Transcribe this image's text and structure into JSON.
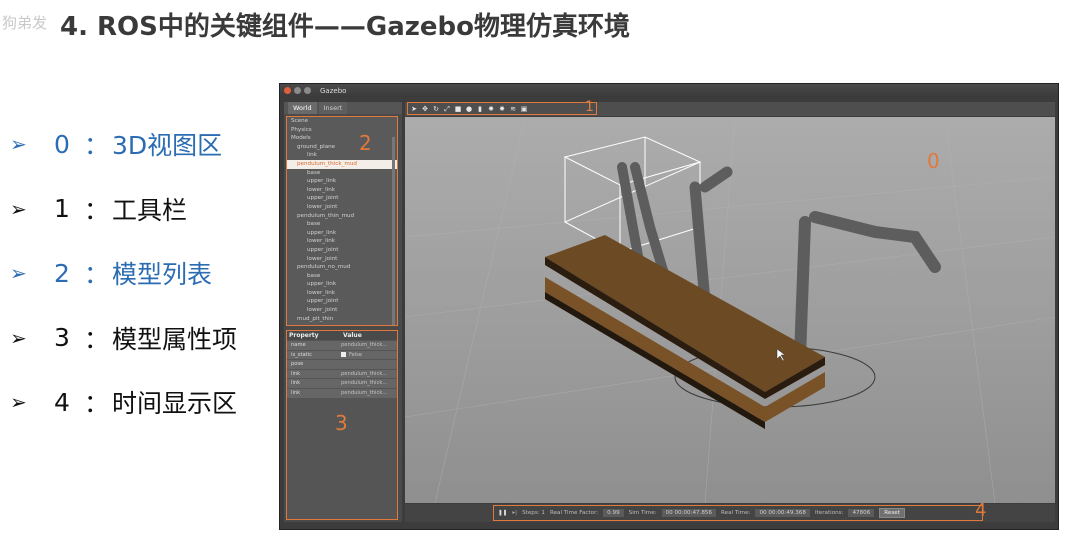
{
  "slide": {
    "title": "4. ROS中的关键组件——Gazebo物理仿真环境",
    "watermark": "狗弟发"
  },
  "bullets": [
    {
      "num": "0",
      "text": "3D视图区",
      "highlight": true
    },
    {
      "num": "1",
      "text": "工具栏",
      "highlight": false
    },
    {
      "num": "2",
      "text": "模型列表",
      "highlight": true
    },
    {
      "num": "3",
      "text": "模型属性项",
      "highlight": false
    },
    {
      "num": "4",
      "text": "时间显示区",
      "highlight": false
    }
  ],
  "bullet_marker": "➢",
  "bullet_colon": "：",
  "gazebo": {
    "window_title": "Gazebo",
    "tabs": [
      "World",
      "Insert"
    ],
    "tree": [
      {
        "label": "Scene",
        "indent": 0
      },
      {
        "label": "Physics",
        "indent": 0
      },
      {
        "label": "Models",
        "indent": 0
      },
      {
        "label": "ground_plane",
        "indent": 1
      },
      {
        "label": "link",
        "indent": 2
      },
      {
        "label": "pendulum_thick_mud",
        "indent": 1,
        "selected": true
      },
      {
        "label": "base",
        "indent": 2
      },
      {
        "label": "upper_link",
        "indent": 2
      },
      {
        "label": "lower_link",
        "indent": 2
      },
      {
        "label": "upper_joint",
        "indent": 2
      },
      {
        "label": "lower_joint",
        "indent": 2
      },
      {
        "label": "pendulum_thin_mud",
        "indent": 1
      },
      {
        "label": "base",
        "indent": 2
      },
      {
        "label": "upper_link",
        "indent": 2
      },
      {
        "label": "lower_link",
        "indent": 2
      },
      {
        "label": "upper_joint",
        "indent": 2
      },
      {
        "label": "lower_joint",
        "indent": 2
      },
      {
        "label": "pendulum_no_mud",
        "indent": 1
      },
      {
        "label": "base",
        "indent": 2
      },
      {
        "label": "upper_link",
        "indent": 2
      },
      {
        "label": "lower_link",
        "indent": 2
      },
      {
        "label": "upper_joint",
        "indent": 2
      },
      {
        "label": "lower_joint",
        "indent": 2
      },
      {
        "label": "mud_pit_thin",
        "indent": 1
      }
    ],
    "props_header": {
      "property": "Property",
      "value": "Value"
    },
    "props": [
      {
        "key": "name",
        "value": "pendulum_thick..."
      },
      {
        "key": "is_static",
        "value": "False",
        "checkbox": true
      },
      {
        "key": "pose",
        "value": ""
      },
      {
        "key": "link",
        "value": "pendulum_thick..."
      },
      {
        "key": "link",
        "value": "pendulum_thick..."
      },
      {
        "key": "link",
        "value": "pendulum_thick..."
      }
    ],
    "toolbar_icons": [
      "select-arrow",
      "translate",
      "rotate",
      "scale",
      "box",
      "sphere",
      "cylinder",
      "point-light",
      "spot-light",
      "directional-light",
      "screenshot"
    ],
    "bottom": {
      "steps_label": "Steps: 1",
      "rtf_label": "Real Time Factor:",
      "rtf_value": "0.99",
      "sim_label": "Sim Time:",
      "sim_value": "00 00:00:47.856",
      "real_label": "Real Time:",
      "real_value": "00 00:00:49.368",
      "iter_label": "Iterations:",
      "iter_value": "47806",
      "reset_label": "Reset"
    },
    "region_labels": {
      "r0": "0",
      "r1": "1",
      "r2": "2",
      "r3": "3",
      "r4": "4"
    },
    "accent_color": "#e07a3c"
  }
}
